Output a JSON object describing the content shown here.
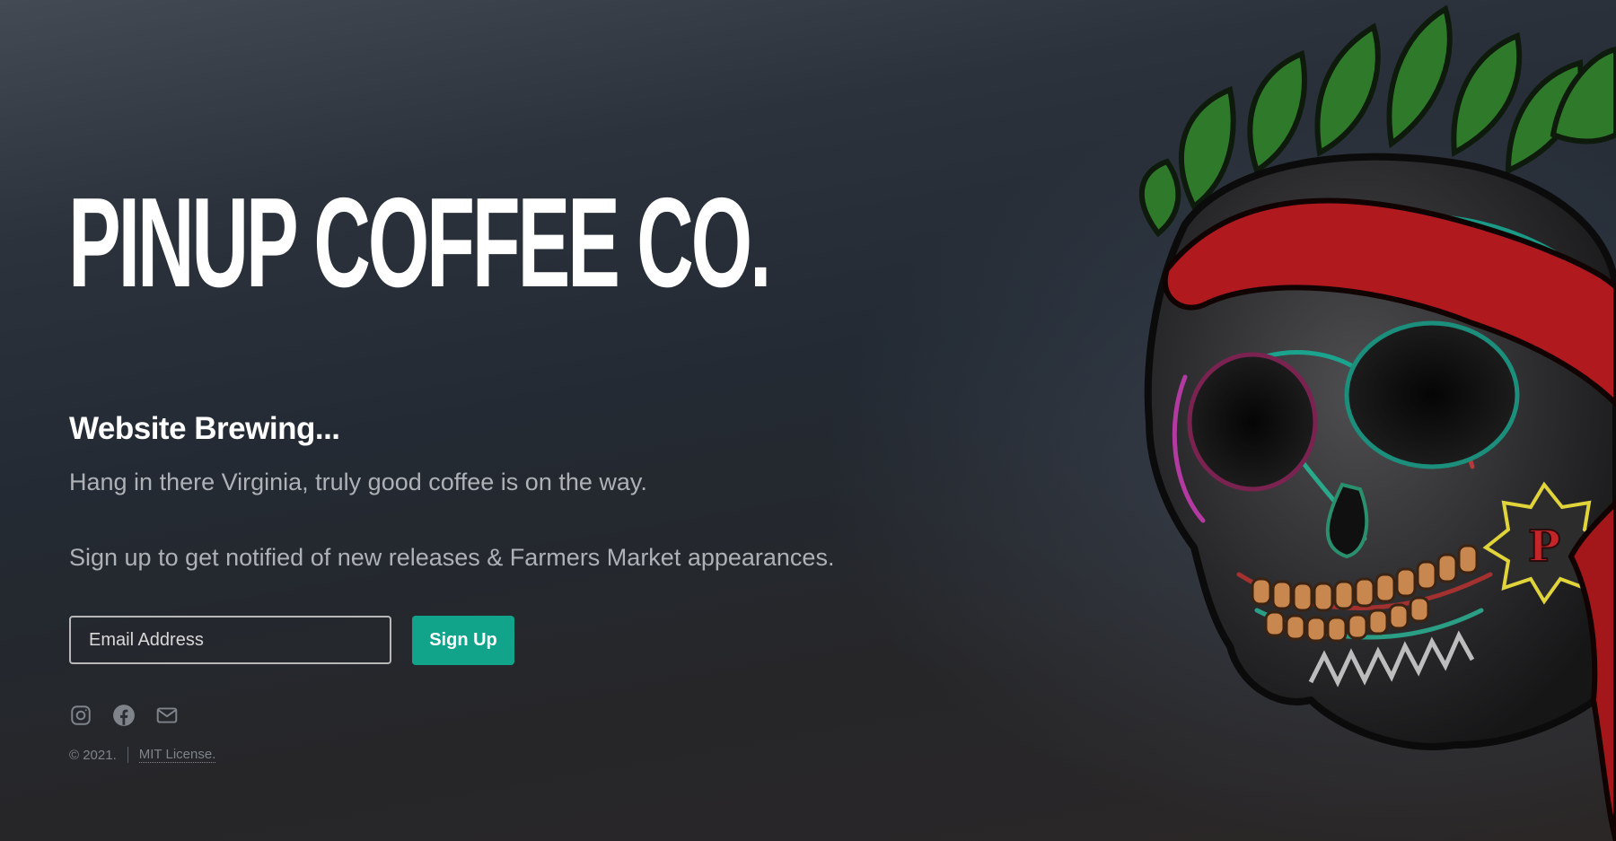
{
  "hero": {
    "title": "PINUP COFFEE CO.",
    "subtitle": "Website Brewing...",
    "tagline": "Hang in there Virginia, truly good coffee is on the way.",
    "signup_text": "Sign up to get notified of new releases & Farmers Market appearances."
  },
  "form": {
    "email_placeholder": "Email Address",
    "submit_label": "Sign Up"
  },
  "social": {
    "icons": [
      "instagram-icon",
      "facebook-icon",
      "mail-icon"
    ]
  },
  "footer": {
    "copyright": "© 2021.",
    "license": "MIT License."
  },
  "colors": {
    "accent": "#12a48a",
    "text_muted": "#aeb1b6",
    "background": "#262a31"
  },
  "illustration": {
    "icon": "skull-illustration",
    "emblem_letter": "P"
  }
}
